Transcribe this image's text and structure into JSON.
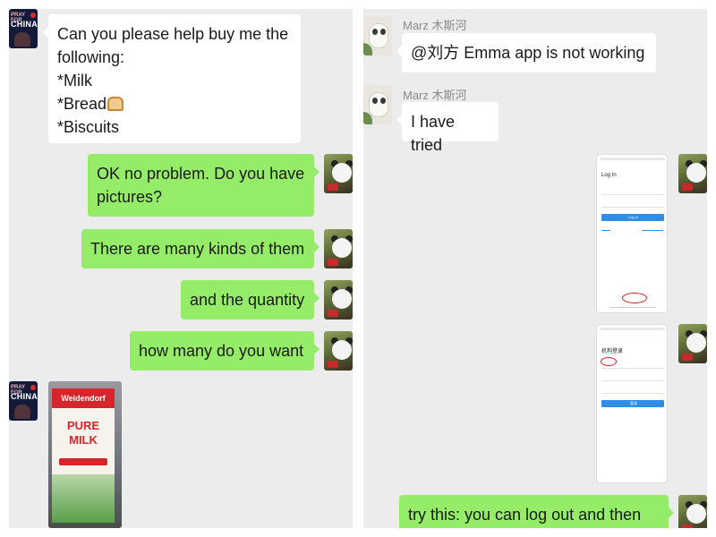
{
  "left_chat": {
    "avatar_china": {
      "tag": "PRAY FOR",
      "name": "CHINA"
    },
    "messages": [
      {
        "lines": [
          "Can you please help buy me the",
          "following:",
          "*Milk",
          "*Bread",
          "*Biscuits"
        ]
      },
      {
        "lines": [
          "OK no problem. Do you have",
          "pictures?"
        ]
      },
      {
        "lines": [
          "There are many kinds of them"
        ]
      },
      {
        "lines": [
          "and the quantity"
        ]
      },
      {
        "lines": [
          "how many do you want"
        ]
      }
    ],
    "milk_photo": {
      "brand": "Weidendorf",
      "product_line1": "PURE",
      "product_line2": "MILK"
    }
  },
  "right_chat": {
    "sender_name": "Marz 木斯河",
    "messages": [
      {
        "text": "@刘方 Emma app is not working"
      },
      {
        "text": "I have tried"
      },
      {
        "text": "try this: you can log out and then"
      }
    ],
    "screenshot_login": {
      "title": "Log In",
      "button": "Log in"
    },
    "screenshot_org": {
      "title": "机构登录",
      "button": "登录"
    }
  }
}
